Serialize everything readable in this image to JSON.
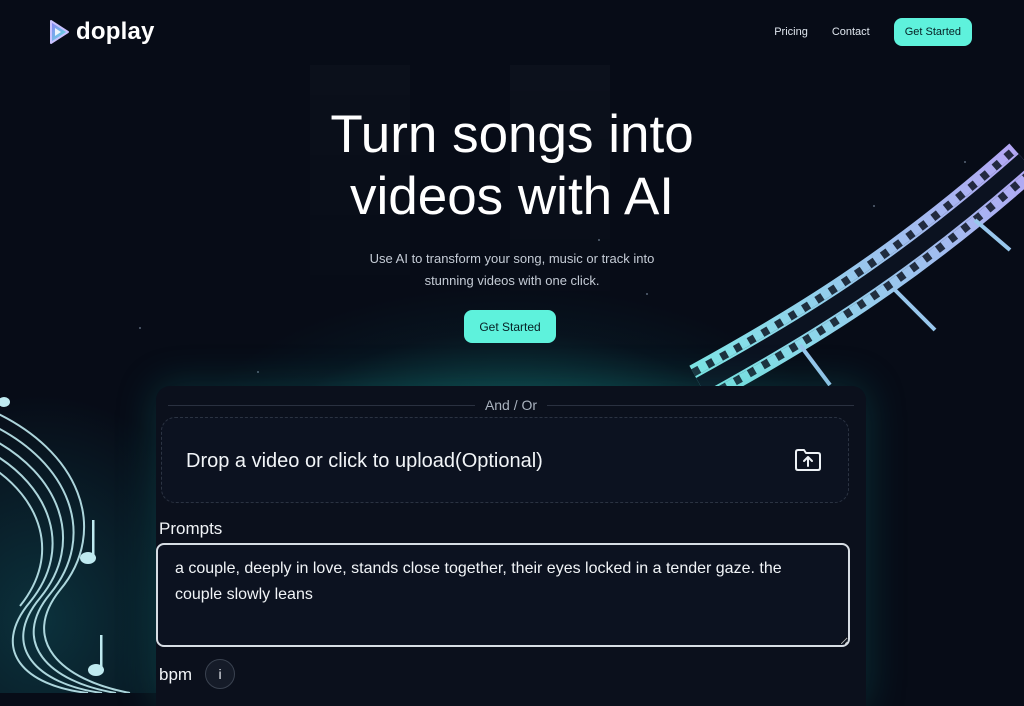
{
  "header": {
    "logo_text": "doplay",
    "nav": {
      "pricing": "Pricing",
      "contact": "Contact",
      "get_started": "Get Started"
    }
  },
  "hero": {
    "title_line1": "Turn songs into",
    "title_line2": "videos with AI",
    "subtitle_line1": "Use AI to transform your song, music or track into",
    "subtitle_line2": "stunning videos with one click.",
    "cta": "Get Started"
  },
  "form": {
    "divider": "And / Or",
    "upload_text": "Drop a video or click to upload(Optional)",
    "prompts_label": "Prompts",
    "prompt_value": "a couple, deeply in love, stands close together, their eyes locked in a tender gaze. the couple slowly leans",
    "bpm_label": "bpm",
    "info_label": "i"
  },
  "icons": [
    "logo-play-icon",
    "upload-folder-icon",
    "info-icon"
  ],
  "colors": {
    "accent": "#5ef2dc",
    "background": "#070c17",
    "film_gradient": [
      "#7ee8e6",
      "#a9a6f2"
    ]
  }
}
